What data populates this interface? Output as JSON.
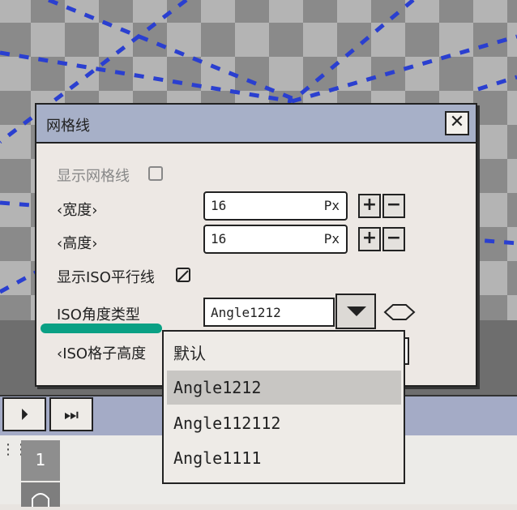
{
  "dialog": {
    "title": "网格线",
    "close_label": "✕",
    "show_grid": {
      "label": "显示网格线",
      "checked": false
    },
    "width": {
      "label": "‹宽度›",
      "value": "16",
      "unit": "Px"
    },
    "height": {
      "label": "‹高度›",
      "value": "16",
      "unit": "Px"
    },
    "show_iso": {
      "label": "显示ISO平行线",
      "checked": true
    },
    "iso_angle": {
      "label": "ISO角度类型",
      "value": "Angle1212"
    },
    "iso_cell_height": {
      "label": "‹ISO格子高度"
    },
    "plus": "+",
    "minus": "−"
  },
  "dropdown": {
    "options": [
      "默认",
      "Angle1212",
      "Angle112112",
      "Angle1111"
    ],
    "selected_index": 1
  },
  "timeline": {
    "play_label": "⏵",
    "end_label": "⏭",
    "frame_number": "1"
  },
  "colors": {
    "titlebar": "#a7b0c8",
    "grid_line": "#2a3fd0",
    "accent_underline": "#0aa084"
  }
}
